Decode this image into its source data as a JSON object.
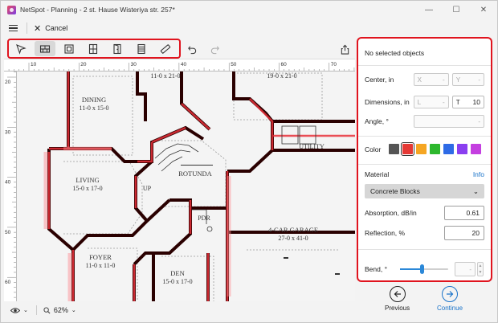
{
  "window": {
    "title": "NetSpot - Planning - 2 st. Hause Wisteriya str. 257*"
  },
  "menubar": {
    "cancel_label": "Cancel"
  },
  "toolbar": {
    "tools": [
      {
        "name": "select-tool"
      },
      {
        "name": "wall-tool",
        "active": true
      },
      {
        "name": "room-tool"
      },
      {
        "name": "window-tool"
      },
      {
        "name": "door-tool"
      },
      {
        "name": "stairs-tool"
      },
      {
        "name": "measure-tool"
      }
    ]
  },
  "ruler": {
    "top_labels": [
      "10",
      "20",
      "30",
      "40",
      "50",
      "60",
      "70"
    ],
    "left_labels": [
      "20",
      "30",
      "40",
      "50",
      "60"
    ]
  },
  "floorplan": {
    "labels": {
      "room_top1": "11-0 x 21-0",
      "room_top2": "19-0 x 21-0",
      "dining": "DINING",
      "dining_dim": "11-0 x 15-0",
      "living": "LIVING",
      "living_dim": "15-0 x 17-0",
      "up": "UP",
      "rotunda": "ROTUNDA",
      "utility": "UTILITY",
      "pdr": "PDR",
      "garage": "4-CAR GARAGE",
      "garage_dim": "27-0 x 41-0",
      "foyer": "FOYER",
      "foyer_dim": "11-0 x 11-0",
      "den": "DEN",
      "den_dim": "15-0 x 17-0"
    }
  },
  "status": {
    "zoom": "62%"
  },
  "panel": {
    "heading": "No selected objects",
    "center_label": "Center, in",
    "center_x": "X",
    "center_y": "Y",
    "dimensions_label": "Dimensions, in",
    "dim_l": "L",
    "dim_t_key": "T",
    "dim_t_value": "10",
    "angle_label": "Angle, °",
    "color_label": "Color",
    "colors": [
      "#555555",
      "#e53935",
      "#f5a623",
      "#2eb82e",
      "#2e6be6",
      "#8a3ff0",
      "#c43fe0"
    ],
    "selected_color_index": 1,
    "material_label": "Material",
    "info_link": "Info",
    "material_value": "Concrete Blocks",
    "absorption_label": "Absorption, dB/in",
    "absorption_value": "0.61",
    "reflection_label": "Reflection, %",
    "reflection_value": "20",
    "bend_label": "Bend, °",
    "bend_level": 0.45
  },
  "nav": {
    "previous": "Previous",
    "continue": "Continue"
  }
}
